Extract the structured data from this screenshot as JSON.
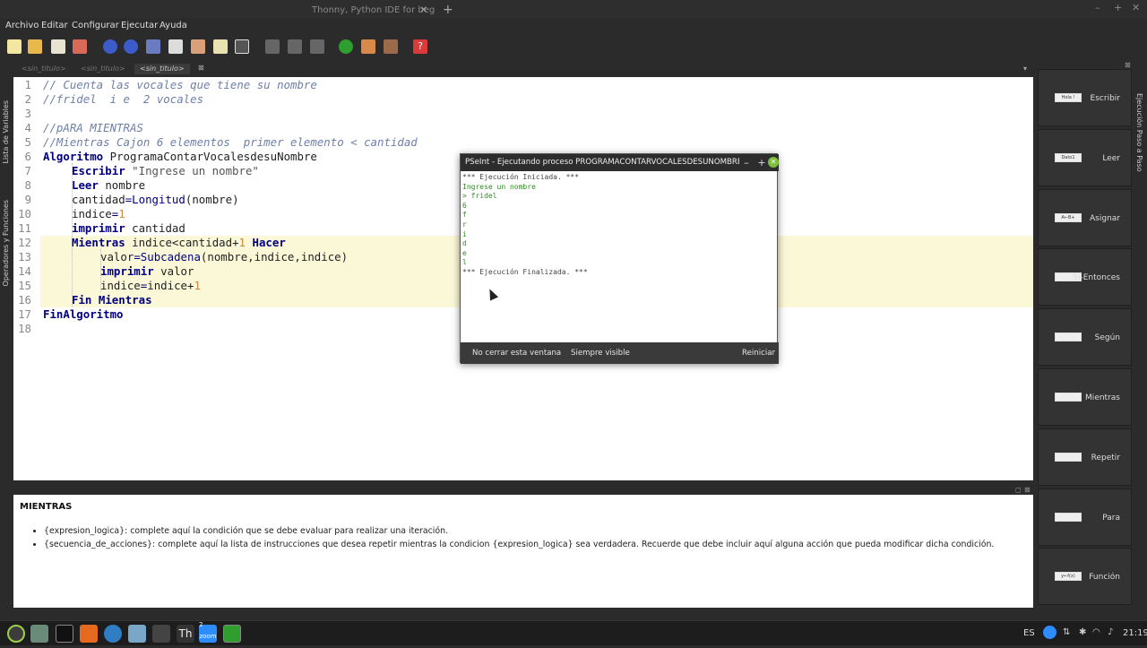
{
  "window": {
    "thonny_tab": "Thonny, Python IDE for beginners",
    "newtab": "+"
  },
  "menu": [
    "Archivo",
    "Editar",
    "Configurar",
    "Ejecutar",
    "Ayuda"
  ],
  "file_tabs": [
    "<sin_titulo>",
    "<sin_titulo>",
    "<sin_titulo>"
  ],
  "left_panels": [
    "Lista de Variables",
    "Operadores y Funciones"
  ],
  "editor": {
    "lines": [
      {
        "n": "1",
        "text": "// Cuenta las vocales que tiene su nombre"
      },
      {
        "n": "2",
        "text": "//fridel  i e  2 vocales"
      },
      {
        "n": "3",
        "text": ""
      },
      {
        "n": "4",
        "text": "//pARA MIENTRAS"
      },
      {
        "n": "5",
        "text": "//Mientras Cajon 6 elementos  primer elemento < cantidad"
      },
      {
        "n": "6",
        "text": "Algoritmo ProgramaContarVocalesdesuNombre"
      },
      {
        "n": "7",
        "text": "Escribir \"Ingrese un nombre\""
      },
      {
        "n": "8",
        "text": "Leer nombre"
      },
      {
        "n": "9",
        "text": "cantidad=Longitud(nombre)"
      },
      {
        "n": "10",
        "text": "indice=1"
      },
      {
        "n": "11",
        "text": "imprimir cantidad"
      },
      {
        "n": "12",
        "text": "Mientras indice<cantidad+1 Hacer"
      },
      {
        "n": "13",
        "text": "valor=Subcadena(nombre,indice,indice)"
      },
      {
        "n": "14",
        "text": "imprimir valor"
      },
      {
        "n": "15",
        "text": "indice=indice+1"
      },
      {
        "n": "16",
        "text": "Fin Mientras"
      },
      {
        "n": "17",
        "text": "FinAlgoritmo"
      },
      {
        "n": "18",
        "text": ""
      }
    ]
  },
  "help": {
    "title": "MIENTRAS",
    "items": [
      "{expresion_logica}: complete aquí la condición que se debe evaluar para realizar una iteración.",
      "{secuencia_de_acciones}: complete aquí la lista de instrucciones que desea repetir mientras la condicion {expresion_logica} sea verdadera. Recuerde que debe incluir aquí alguna acción que pueda modificar dicha condición."
    ]
  },
  "commands_panel": {
    "items": [
      {
        "label": "Escribir",
        "icon": "Hola !"
      },
      {
        "label": "Leer",
        "icon": "Dato1"
      },
      {
        "label": "Asignar",
        "icon": "A←B+"
      },
      {
        "label": "Si-Entonces",
        "icon": "si-entonces-icon"
      },
      {
        "label": "Según",
        "icon": "segun-icon"
      },
      {
        "label": "Mientras",
        "icon": "mientras-icon"
      },
      {
        "label": "Repetir",
        "icon": "repetir-icon"
      },
      {
        "label": "Para",
        "icon": "para-icon"
      },
      {
        "label": "Función",
        "icon": "y←f(x)"
      }
    ],
    "side_label": "Ejecución Paso a Paso"
  },
  "dialog": {
    "title": "PSeInt - Ejecutando proceso PROGRAMACONTARVOCALESDESUNOMBRE",
    "output": [
      "*** Ejecución Iniciada. ***",
      "Ingrese un nombre",
      "> fridel",
      "6",
      "f",
      "r",
      "i",
      "d",
      "e",
      "l",
      "*** Ejecución Finalizada. ***"
    ],
    "buttons": {
      "no_close": "No cerrar esta ventana",
      "always_visible": "Siempre visible",
      "restart": "Reiniciar"
    }
  },
  "tray": {
    "lang": "ES",
    "clock": "21:19"
  },
  "taskbar_badge": "2",
  "taskbar_zoom": "zoom",
  "taskbar_th": "Th"
}
